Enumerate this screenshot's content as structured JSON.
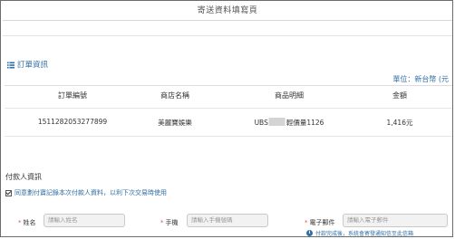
{
  "page_title": "寄送資料填寫頁",
  "order_section": {
    "heading": "訂單資訊",
    "unit_label": "單位：新台幣 (元",
    "columns": [
      "訂單編號",
      "商店名稱",
      "商品明細",
      "金額"
    ],
    "row": {
      "order_no": "1511282053277899",
      "store": "美麗寶娛樂",
      "item_prefix": "UBS",
      "item_suffix": "輕價量1126",
      "amount": "1,416元"
    }
  },
  "payer_section": {
    "heading": "付款人資訊",
    "agree_label": "同意劃付寶記錄本次付款人資料，以利下次交易時使用",
    "name_label": "姓名",
    "name_placeholder": "請輸入姓名",
    "phone_label": "手機",
    "phone_placeholder": "請輸入手機號碼",
    "email_label": "電子郵件",
    "email_placeholder": "請輸入電子郵件",
    "note": "付款完成後，系統會寄發通知信至此信箱"
  },
  "colors": {
    "accent": "#2f6fa5",
    "required": "#d9534f",
    "input_bg": "#f2f2f2"
  }
}
